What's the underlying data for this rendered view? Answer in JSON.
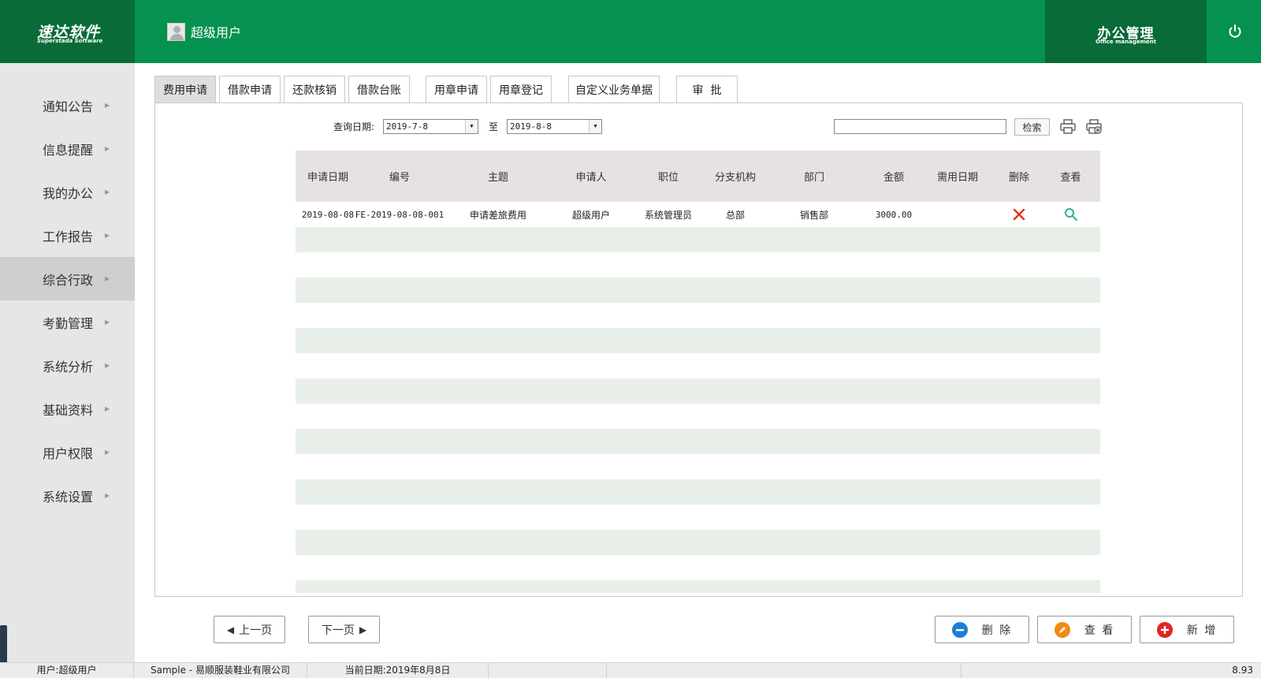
{
  "header": {
    "logo_cn": "速达软件",
    "logo_en": "Superstada Software",
    "user_name": "超级用户",
    "module_cn": "办公管理",
    "module_en": "Office management",
    "brand_color": "#05914f",
    "brand_dark": "#096b38"
  },
  "sidebar": {
    "items": [
      {
        "label": "通知公告"
      },
      {
        "label": "信息提醒"
      },
      {
        "label": "我的办公"
      },
      {
        "label": "工作报告"
      },
      {
        "label": "综合行政"
      },
      {
        "label": "考勤管理"
      },
      {
        "label": "系统分析"
      },
      {
        "label": "基础资料"
      },
      {
        "label": "用户权限"
      },
      {
        "label": "系统设置"
      }
    ],
    "active_label": "综合行政"
  },
  "tabs": [
    {
      "label": "费用申请"
    },
    {
      "label": "借款申请"
    },
    {
      "label": "还款核销"
    },
    {
      "label": "借款台账"
    },
    {
      "label": "用章申请"
    },
    {
      "label": "用章登记"
    },
    {
      "label": "自定义业务单据"
    },
    {
      "label": "审  批"
    }
  ],
  "active_tab": "费用申请",
  "filter": {
    "date_label": "查询日期:",
    "date_from": "2019-7-8",
    "to_label": "至",
    "date_to": "2019-8-8",
    "search_value": "",
    "search_button": "检索"
  },
  "table": {
    "columns": [
      "申请日期",
      "编号",
      "主题",
      "申请人",
      "职位",
      "分支机构",
      "部门",
      "金额",
      "需用日期",
      "删除",
      "查看"
    ],
    "rows": [
      {
        "date": "2019-08-08",
        "number": "FE-2019-08-08-001",
        "subject": "申请差旅费用",
        "applicant": "超级用户",
        "position": "系统管理员",
        "branch": "总部",
        "department": "销售部",
        "amount": "3000.00",
        "need_date": ""
      }
    ]
  },
  "pager": {
    "prev": "上一页",
    "next": "下一页"
  },
  "actions": {
    "delete": "删 除",
    "view": "查 看",
    "add": "新 增"
  },
  "status": {
    "user": "用户:超级用户",
    "company": "Sample - 易顺服装鞋业有限公司",
    "date": "当前日期:2019年8月8日",
    "version": "8.93"
  }
}
